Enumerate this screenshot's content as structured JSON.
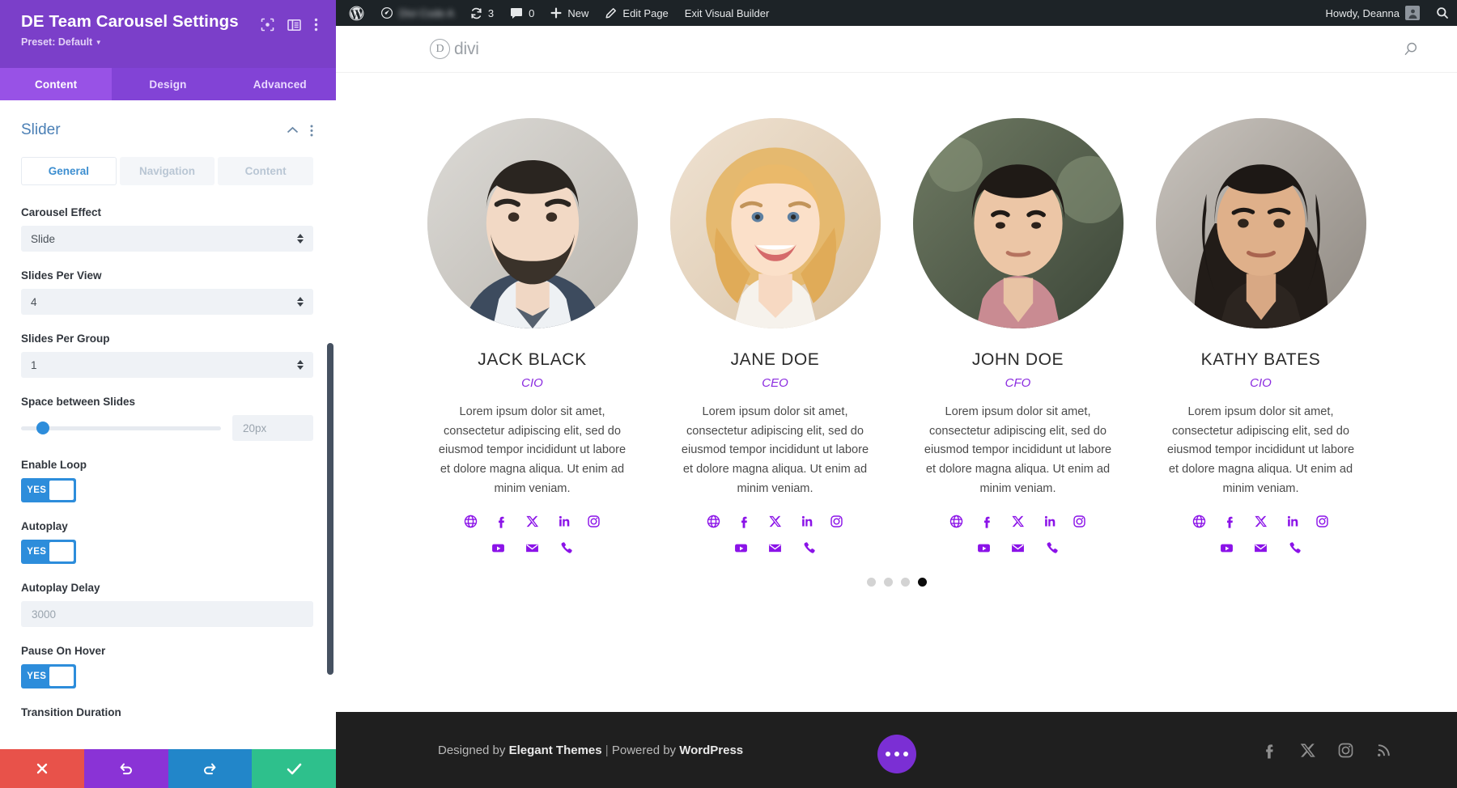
{
  "settings_panel": {
    "title": "DE Team Carousel Settings",
    "preset": "Preset: Default",
    "header_icons": [
      "focus-icon",
      "layout-icon",
      "more-vertical-icon"
    ],
    "tabs": [
      {
        "label": "Content",
        "active": true
      },
      {
        "label": "Design",
        "active": false
      },
      {
        "label": "Advanced",
        "active": false
      }
    ],
    "section": {
      "title": "Slider",
      "icons": [
        "chevron-up-icon",
        "more-vertical-icon"
      ]
    },
    "subtabs": [
      {
        "label": "General",
        "active": true
      },
      {
        "label": "Navigation",
        "active": false
      },
      {
        "label": "Content",
        "active": false
      }
    ],
    "fields": {
      "carousel_effect": {
        "label": "Carousel Effect",
        "value": "Slide"
      },
      "slides_per_view": {
        "label": "Slides Per View",
        "value": "4"
      },
      "slides_per_group": {
        "label": "Slides Per Group",
        "value": "1"
      },
      "space_between": {
        "label": "Space between Slides",
        "value": "20px",
        "slider_pct": 11
      },
      "enable_loop": {
        "label": "Enable Loop",
        "value": "YES"
      },
      "autoplay": {
        "label": "Autoplay",
        "value": "YES"
      },
      "autoplay_delay": {
        "label": "Autoplay Delay",
        "value": "3000"
      },
      "pause_on_hover": {
        "label": "Pause On Hover",
        "value": "YES"
      },
      "transition_duration": {
        "label": "Transition Duration"
      }
    },
    "footer_buttons": [
      {
        "name": "cancel-button",
        "icon": "close-icon",
        "color": "#e8524a"
      },
      {
        "name": "undo-button",
        "icon": "undo-icon",
        "color": "#8a33d6"
      },
      {
        "name": "redo-button",
        "icon": "redo-icon",
        "color": "#2286c9"
      },
      {
        "name": "save-button",
        "icon": "check-icon",
        "color": "#2ec08c"
      }
    ]
  },
  "admin_bar": {
    "site_name": "Divi Code A",
    "updates_count": "3",
    "comments_count": "0",
    "new_label": "New",
    "edit_page_label": "Edit Page",
    "exit_builder_label": "Exit Visual Builder",
    "howdy": "Howdy, Deanna"
  },
  "site_header": {
    "logo_letter": "D",
    "logo_word": "divi",
    "search_icon": "search-icon"
  },
  "carousel": {
    "members": [
      {
        "name": "JACK BLACK",
        "role": "CIO",
        "description": "Lorem ipsum dolor sit amet, consectetur adipiscing elit, sed do eiusmod tempor incididunt ut labore et dolore magna aliqua. Ut enim ad minim veniam.",
        "photo": "man-beard-portrait",
        "socials_row1": [
          "globe-icon",
          "facebook-icon",
          "x-icon",
          "linkedin-icon",
          "instagram-icon"
        ],
        "socials_row2": [
          "youtube-icon",
          "email-icon",
          "phone-icon"
        ]
      },
      {
        "name": "JANE DOE",
        "role": "CEO",
        "description": "Lorem ipsum dolor sit amet, consectetur adipiscing elit, sed do eiusmod tempor incididunt ut labore et dolore magna aliqua. Ut enim ad minim veniam.",
        "photo": "woman-blonde-portrait",
        "socials_row1": [
          "globe-icon",
          "facebook-icon",
          "x-icon",
          "linkedin-icon",
          "instagram-icon"
        ],
        "socials_row2": [
          "youtube-icon",
          "email-icon",
          "phone-icon"
        ]
      },
      {
        "name": "JOHN DOE",
        "role": "CFO",
        "description": "Lorem ipsum dolor sit amet, consectetur adipiscing elit, sed do eiusmod tempor incididunt ut labore et dolore magna aliqua. Ut enim ad minim veniam.",
        "photo": "man-asian-portrait",
        "socials_row1": [
          "globe-icon",
          "facebook-icon",
          "x-icon",
          "linkedin-icon",
          "instagram-icon"
        ],
        "socials_row2": [
          "youtube-icon",
          "email-icon",
          "phone-icon"
        ]
      },
      {
        "name": "KATHY BATES",
        "role": "CIO",
        "description": "Lorem ipsum dolor sit amet, consectetur adipiscing elit, sed do eiusmod tempor incididunt ut labore et dolore magna aliqua. Ut enim ad minim veniam.",
        "photo": "woman-dark-hair-portrait",
        "socials_row1": [
          "globe-icon",
          "facebook-icon",
          "x-icon",
          "linkedin-icon",
          "instagram-icon"
        ],
        "socials_row2": [
          "youtube-icon",
          "email-icon",
          "phone-icon"
        ]
      }
    ],
    "pagination": {
      "total": 4,
      "active_index": 3
    }
  },
  "site_footer": {
    "designed_by": "Designed by ",
    "elegant_themes": "Elegant Themes",
    "separator": " | ",
    "powered_by": "Powered by ",
    "wordpress": "WordPress",
    "socials": [
      "facebook-icon",
      "x-icon",
      "instagram-icon",
      "rss-icon"
    ]
  },
  "fab": {
    "name": "builder-menu-button",
    "icon": "ellipsis-icon"
  },
  "colors": {
    "panel_purple": "#7b3fc9",
    "tab_purple": "#9852e6",
    "accent_blue": "#2d8ddb",
    "role_purple": "#8b2ce0",
    "social_purple": "#8b13e8",
    "admin_dark": "#1d2327",
    "footer_dark": "#1f1f1f"
  }
}
